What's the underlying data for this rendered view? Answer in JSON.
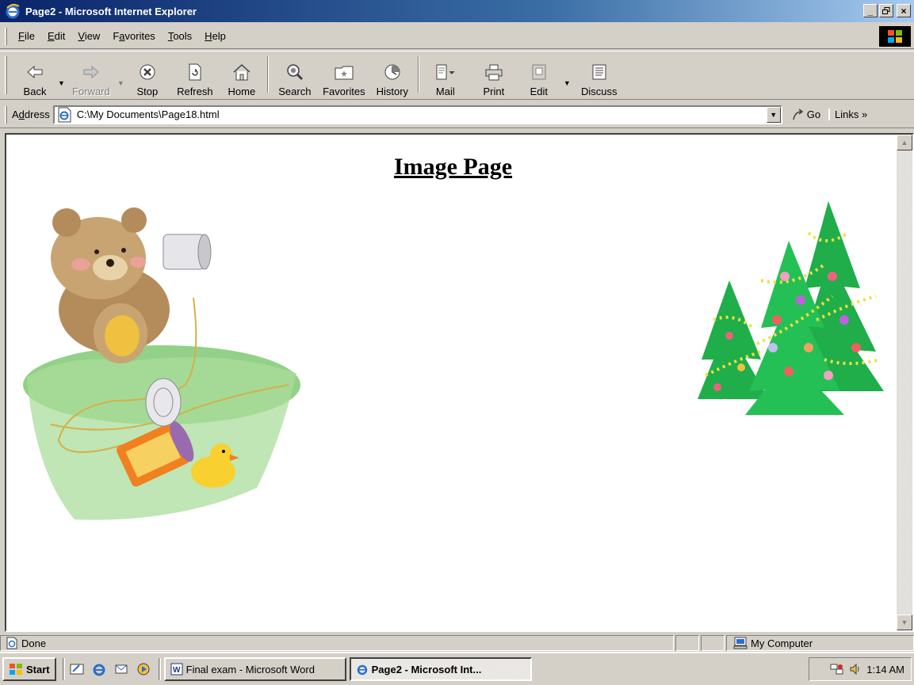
{
  "window": {
    "title": "Page2 - Microsoft Internet Explorer",
    "min": "_",
    "max": "▫",
    "close": "×"
  },
  "menu": {
    "items": [
      {
        "pre": "",
        "ul": "F",
        "post": "ile"
      },
      {
        "pre": "",
        "ul": "E",
        "post": "dit"
      },
      {
        "pre": "",
        "ul": "V",
        "post": "iew"
      },
      {
        "pre": "F",
        "ul": "a",
        "post": "vorites"
      },
      {
        "pre": "",
        "ul": "T",
        "post": "ools"
      },
      {
        "pre": "",
        "ul": "H",
        "post": "elp"
      }
    ]
  },
  "toolbar": {
    "back": "Back",
    "forward": "Forward",
    "stop": "Stop",
    "refresh": "Refresh",
    "home": "Home",
    "search": "Search",
    "favorites": "Favorites",
    "history": "History",
    "mail": "Mail",
    "print": "Print",
    "edit": "Edit",
    "discuss": "Discuss"
  },
  "address": {
    "label_pre": "A",
    "label_ul": "d",
    "label_post": "dress",
    "url": "C:\\My Documents\\Page18.html",
    "go": "Go",
    "links": "Links »"
  },
  "page": {
    "heading": "Image Page"
  },
  "status": {
    "text": "Done",
    "zone": "My Computer"
  },
  "taskbar": {
    "start": "Start",
    "task1": "Final exam - Microsoft Word",
    "task2": "Page2 - Microsoft Int...",
    "clock": "1:14 AM"
  },
  "colors": {
    "title_bar": "#0a246a",
    "chrome": "#d4d0c8",
    "tree_green": "#1fae4a"
  }
}
